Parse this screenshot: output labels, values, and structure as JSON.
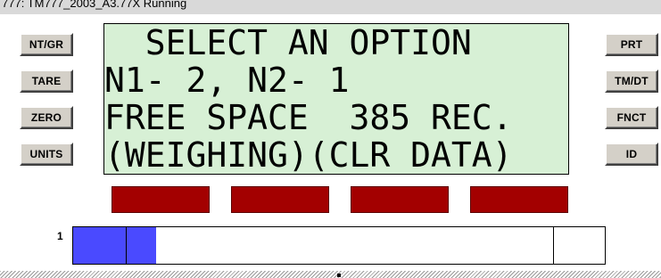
{
  "window": {
    "title": "777: TM777_2003_A3.77X Running"
  },
  "left_buttons": [
    "NT/GR",
    "TARE",
    "ZERO",
    "UNITS"
  ],
  "right_buttons": [
    "PRT",
    "TM/DT",
    "FNCT",
    "ID"
  ],
  "display": {
    "lines": [
      "  SELECT AN OPTION",
      "N1- 2, N2- 1",
      "FREE SPACE  385 REC.",
      "(WEIGHING)(CLR DATA)"
    ]
  },
  "softkeys": {
    "count": 4,
    "color": "#a30000"
  },
  "progress": {
    "label": "1",
    "fill_color": "#4a4aff"
  }
}
